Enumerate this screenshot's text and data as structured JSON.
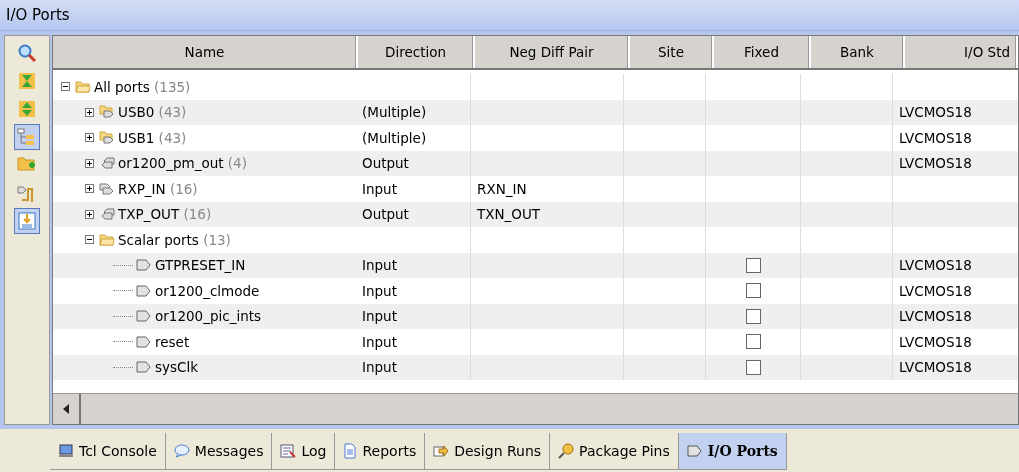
{
  "window": {
    "title": "I/O Ports"
  },
  "toolbar": [
    {
      "kind": "search",
      "pressed": false
    },
    {
      "kind": "collapse",
      "pressed": false
    },
    {
      "kind": "expand",
      "pressed": false
    },
    {
      "kind": "group",
      "pressed": true
    },
    {
      "kind": "add-folder",
      "pressed": false
    },
    {
      "kind": "place",
      "pressed": false
    },
    {
      "kind": "auto",
      "pressed": true
    }
  ],
  "table": {
    "columns": [
      "Name",
      "Direction",
      "Neg Diff Pair",
      "Site",
      "Fixed",
      "Bank",
      "I/O Std"
    ],
    "rows": [
      {
        "kind": "folder",
        "name": "All ports",
        "count": "(135)",
        "expanded": true,
        "children": [
          {
            "kind": "bus-group",
            "name": "USB0",
            "count": "(43)",
            "expanded": false,
            "direction": "(Multiple)",
            "io_std": "LVCMOS18"
          },
          {
            "kind": "bus-group",
            "name": "USB1",
            "count": "(43)",
            "expanded": false,
            "direction": "(Multiple)",
            "io_std": "LVCMOS18"
          },
          {
            "kind": "out-bus",
            "name": "or1200_pm_out",
            "count": "(4)",
            "expanded": false,
            "direction": "Output",
            "io_std": "LVCMOS18"
          },
          {
            "kind": "in-bus",
            "name": "RXP_IN",
            "count": "(16)",
            "expanded": false,
            "direction": "Input",
            "neg_diff_pair": "RXN_IN"
          },
          {
            "kind": "out-bus",
            "name": "TXP_OUT",
            "count": "(16)",
            "expanded": false,
            "direction": "Output",
            "neg_diff_pair": "TXN_OUT"
          },
          {
            "kind": "folder",
            "name": "Scalar ports",
            "count": "(13)",
            "expanded": true,
            "children": [
              {
                "kind": "port",
                "name": "GTPRESET_IN",
                "direction": "Input",
                "fixed": false,
                "io_std": "LVCMOS18"
              },
              {
                "kind": "port",
                "name": "or1200_clmode",
                "direction": "Input",
                "fixed": false,
                "io_std": "LVCMOS18"
              },
              {
                "kind": "port",
                "name": "or1200_pic_ints",
                "direction": "Input",
                "fixed": false,
                "io_std": "LVCMOS18"
              },
              {
                "kind": "port",
                "name": "reset",
                "direction": "Input",
                "fixed": false,
                "io_std": "LVCMOS18"
              },
              {
                "kind": "port",
                "name": "sysClk",
                "direction": "Input",
                "fixed": false,
                "io_std": "LVCMOS18"
              }
            ]
          }
        ]
      }
    ]
  },
  "tabs": [
    {
      "kind": "console",
      "label": "Tcl Console",
      "selected": false
    },
    {
      "kind": "messages",
      "label": "Messages",
      "selected": false
    },
    {
      "kind": "log",
      "label": "Log",
      "selected": false
    },
    {
      "kind": "reports",
      "label": "Reports",
      "selected": false
    },
    {
      "kind": "runs",
      "label": "Design Runs",
      "selected": false
    },
    {
      "kind": "pins",
      "label": "Package Pins",
      "selected": false
    },
    {
      "kind": "port",
      "label": "I/O Ports",
      "selected": true
    }
  ]
}
